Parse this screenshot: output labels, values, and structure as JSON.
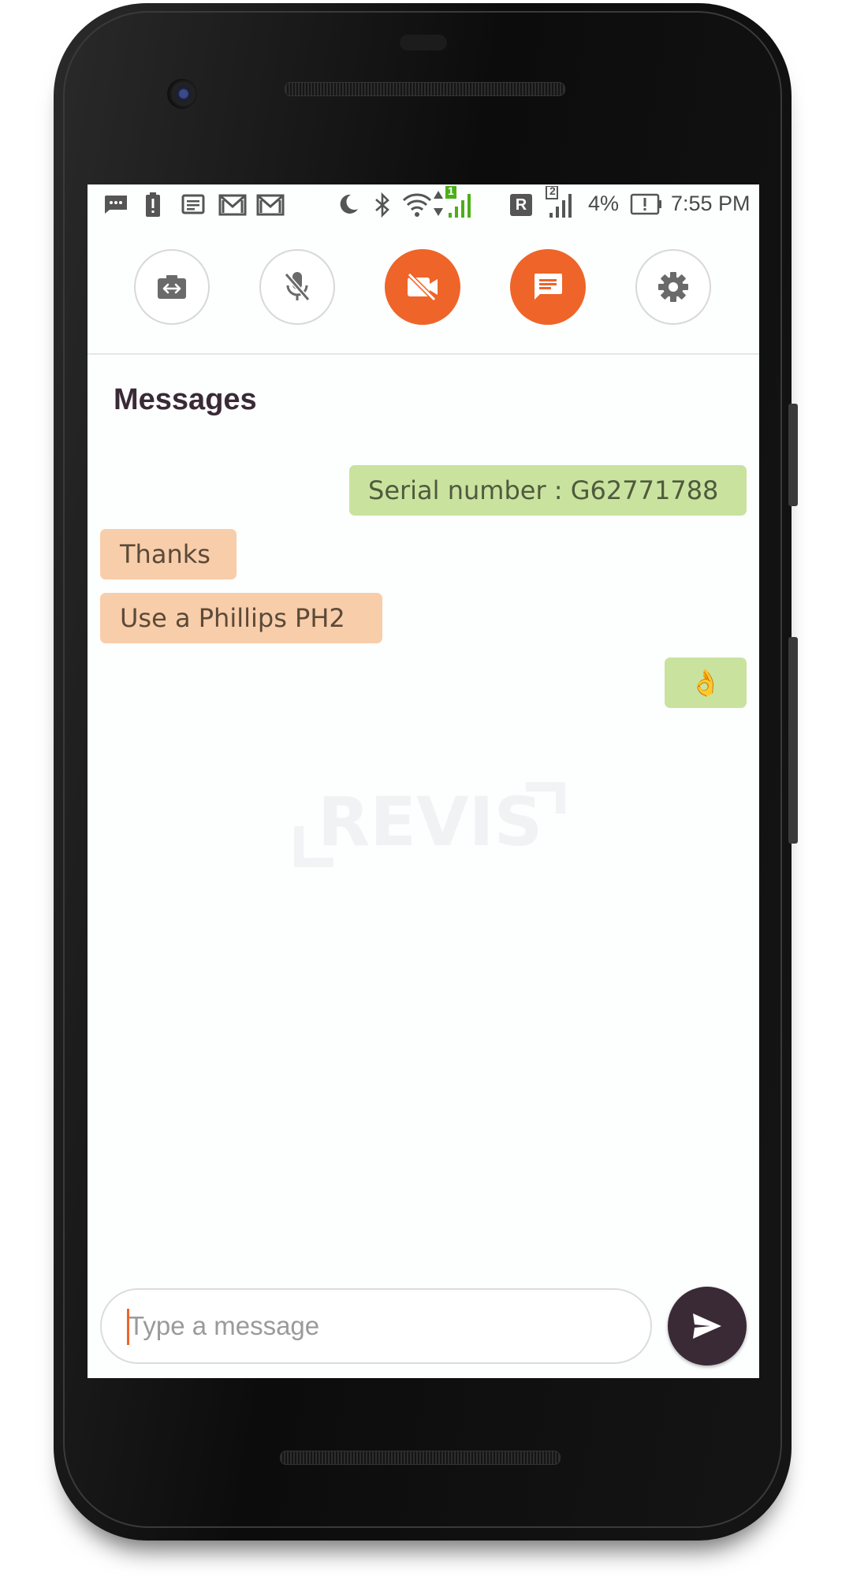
{
  "status_bar": {
    "battery_percent": "4%",
    "time": "7:55 PM",
    "sim1_badge": "1",
    "sim2_badge": "2",
    "roaming_label": "R",
    "icons": [
      "sms-icon",
      "battery-alert-icon",
      "notes-icon",
      "gmail-icon",
      "gmail-icon",
      "do-not-disturb-moon-icon",
      "bluetooth-icon",
      "wifi-icon",
      "signal-icon",
      "roaming-icon",
      "signal-icon",
      "battery-icon"
    ]
  },
  "controls": [
    {
      "name": "switch-camera-button",
      "icon": "switch-camera-icon",
      "state": "inactive"
    },
    {
      "name": "mute-mic-button",
      "icon": "mic-off-icon",
      "state": "inactive"
    },
    {
      "name": "video-off-button",
      "icon": "videocam-off-icon",
      "state": "active"
    },
    {
      "name": "chat-button",
      "icon": "chat-icon",
      "state": "active"
    },
    {
      "name": "settings-button",
      "icon": "gear-icon",
      "state": "inactive"
    }
  ],
  "messages_panel": {
    "title": "Messages",
    "messages": [
      {
        "direction": "outgoing",
        "text": "Serial number : G62771788"
      },
      {
        "direction": "incoming",
        "text": "Thanks"
      },
      {
        "direction": "incoming",
        "text": "Use a  Phillips PH2"
      },
      {
        "direction": "outgoing",
        "text": "👌"
      }
    ],
    "watermark_text": "REVIS"
  },
  "composer": {
    "placeholder": "Type a message",
    "value": ""
  },
  "colors": {
    "accent": "#ef6428",
    "outgoing_bubble": "#c9e39f",
    "incoming_bubble": "#f8cda9",
    "send_button": "#3a2a36",
    "heading": "#3a2a36"
  }
}
